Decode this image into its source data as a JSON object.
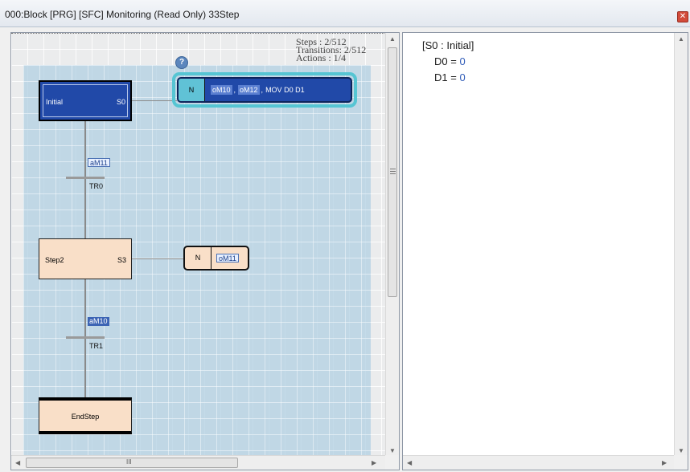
{
  "window": {
    "title": "000:Block [PRG] [SFC] Monitoring (Read Only) 33Step"
  },
  "info": {
    "steps": "Steps    : 2/512",
    "transitions": "Transitions: 2/512",
    "actions": "Actions   : 1/4"
  },
  "steps": [
    {
      "name": "Initial",
      "id": "S0",
      "active": true
    },
    {
      "name": "Step2",
      "id": "S3",
      "active": false
    },
    {
      "name": "EndStep",
      "id": ""
    }
  ],
  "transitions": [
    {
      "name": "TR0",
      "condition": "aM11",
      "active": false
    },
    {
      "name": "TR1",
      "condition": "aM10",
      "active": true
    }
  ],
  "actions": [
    {
      "qualifier": "N",
      "chip1": "oM10",
      "chip2": "oM12",
      "text": "MOV D0 D1",
      "active": true
    },
    {
      "qualifier": "N",
      "chip1": "oM11",
      "active": false
    }
  ],
  "monitor": {
    "header": "[S0 : Initial]",
    "rows": [
      {
        "name": "D0",
        "eq": " = ",
        "value": "0"
      },
      {
        "name": "D1",
        "eq": " = ",
        "value": "0"
      }
    ]
  },
  "scrollbar": {
    "grip": "III"
  },
  "colors": {
    "active_step": "#2149a8",
    "inactive_step": "#f9dfc8",
    "highlight_ring": "#56c5d3"
  }
}
